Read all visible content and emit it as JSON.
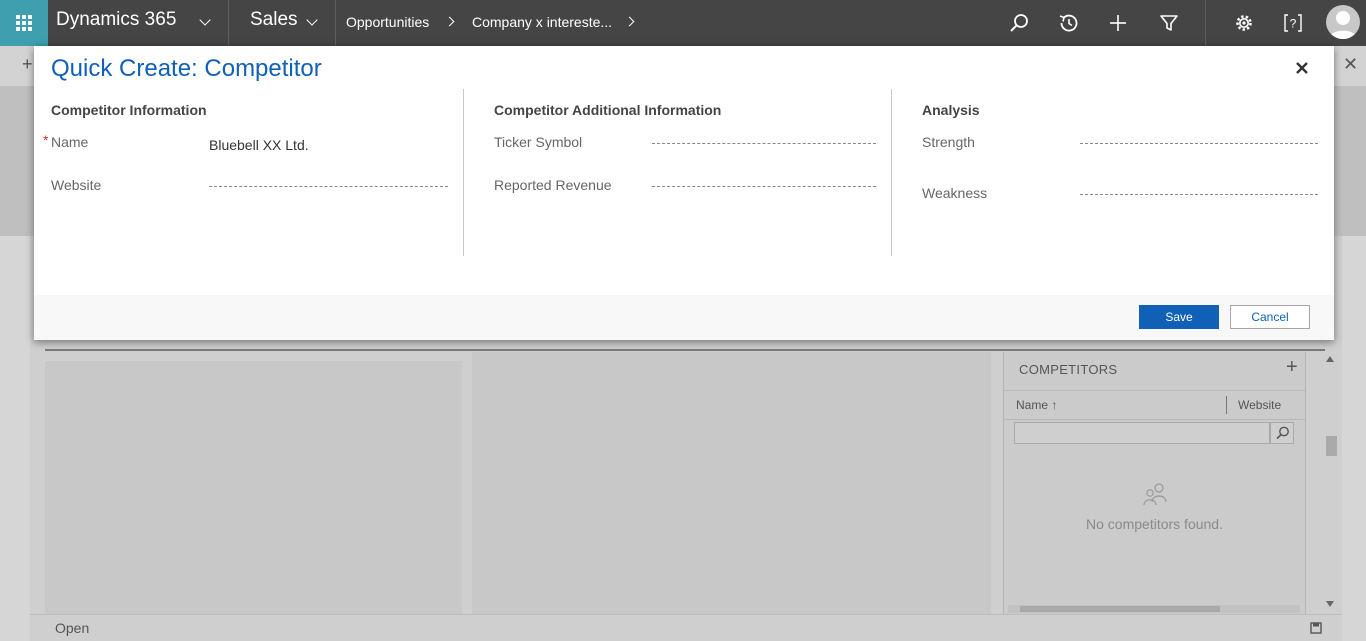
{
  "nav": {
    "app_name": "Dynamics 365",
    "module": "Sales",
    "breadcrumb": [
      "Opportunities",
      "Company x intereste..."
    ]
  },
  "colors": {
    "nav_bg": "#454545",
    "waffle_bg": "#3f9fae",
    "accent": "#1160b7",
    "required": "#c0392b"
  },
  "modal": {
    "title": "Quick Create: Competitor",
    "sections": {
      "info": {
        "title": "Competitor Information",
        "name_label": "Name",
        "name_value": "Bluebell XX Ltd.",
        "website_label": "Website",
        "website_value": ""
      },
      "additional": {
        "title": "Competitor Additional Information",
        "ticker_label": "Ticker Symbol",
        "ticker_value": "",
        "revenue_label": "Reported Revenue",
        "revenue_value": ""
      },
      "analysis": {
        "title": "Analysis",
        "strength_label": "Strength",
        "strength_value": "",
        "weakness_label": "Weakness",
        "weakness_value": ""
      }
    },
    "required_marker": "*",
    "save_label": "Save",
    "cancel_label": "Cancel",
    "close_icon": "close-icon"
  },
  "background": {
    "plus_glyph": "+",
    "close_glyph": "✕",
    "competitors_panel": {
      "title": "COMPETITORS",
      "add_glyph": "+",
      "columns": [
        "Name ↑",
        "Website"
      ],
      "empty_text": "No competitors found."
    },
    "footer_status": "Open"
  },
  "icons": {
    "waffle": "waffle-icon",
    "search": "search-icon",
    "recent": "history-icon",
    "new": "plus-icon",
    "filter": "filter-icon",
    "settings": "gear-icon",
    "help": "help-icon",
    "user": "avatar-icon"
  }
}
